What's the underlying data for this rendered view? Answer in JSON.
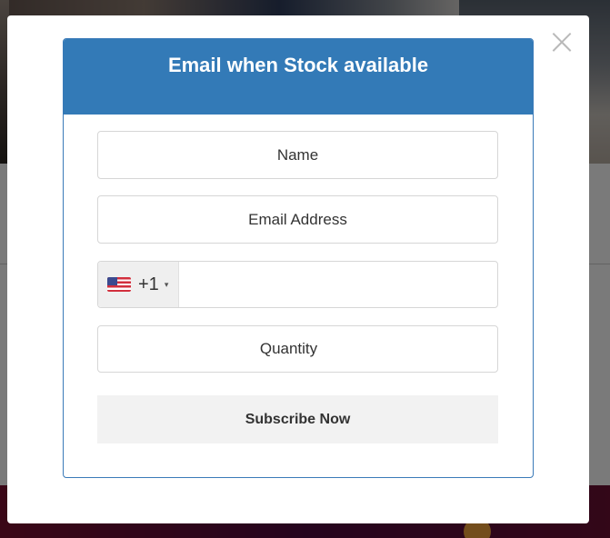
{
  "modal": {
    "title": "Email when Stock available",
    "close_symbol": "×",
    "close_icon": "close-icon",
    "name_placeholder": "Name",
    "email_placeholder": "Email Address",
    "phone": {
      "country_flag": "us-flag-icon",
      "dial_code": "+1",
      "dropdown_icon": "caret-down-icon",
      "dropdown_symbol": "▾"
    },
    "quantity_placeholder": "Quantity",
    "submit_label": "Subscribe Now"
  },
  "colors": {
    "header_blue": "#337ab7",
    "overlay": "rgba(0,0,0,0.52)",
    "button_bg": "#f2f2f2"
  }
}
